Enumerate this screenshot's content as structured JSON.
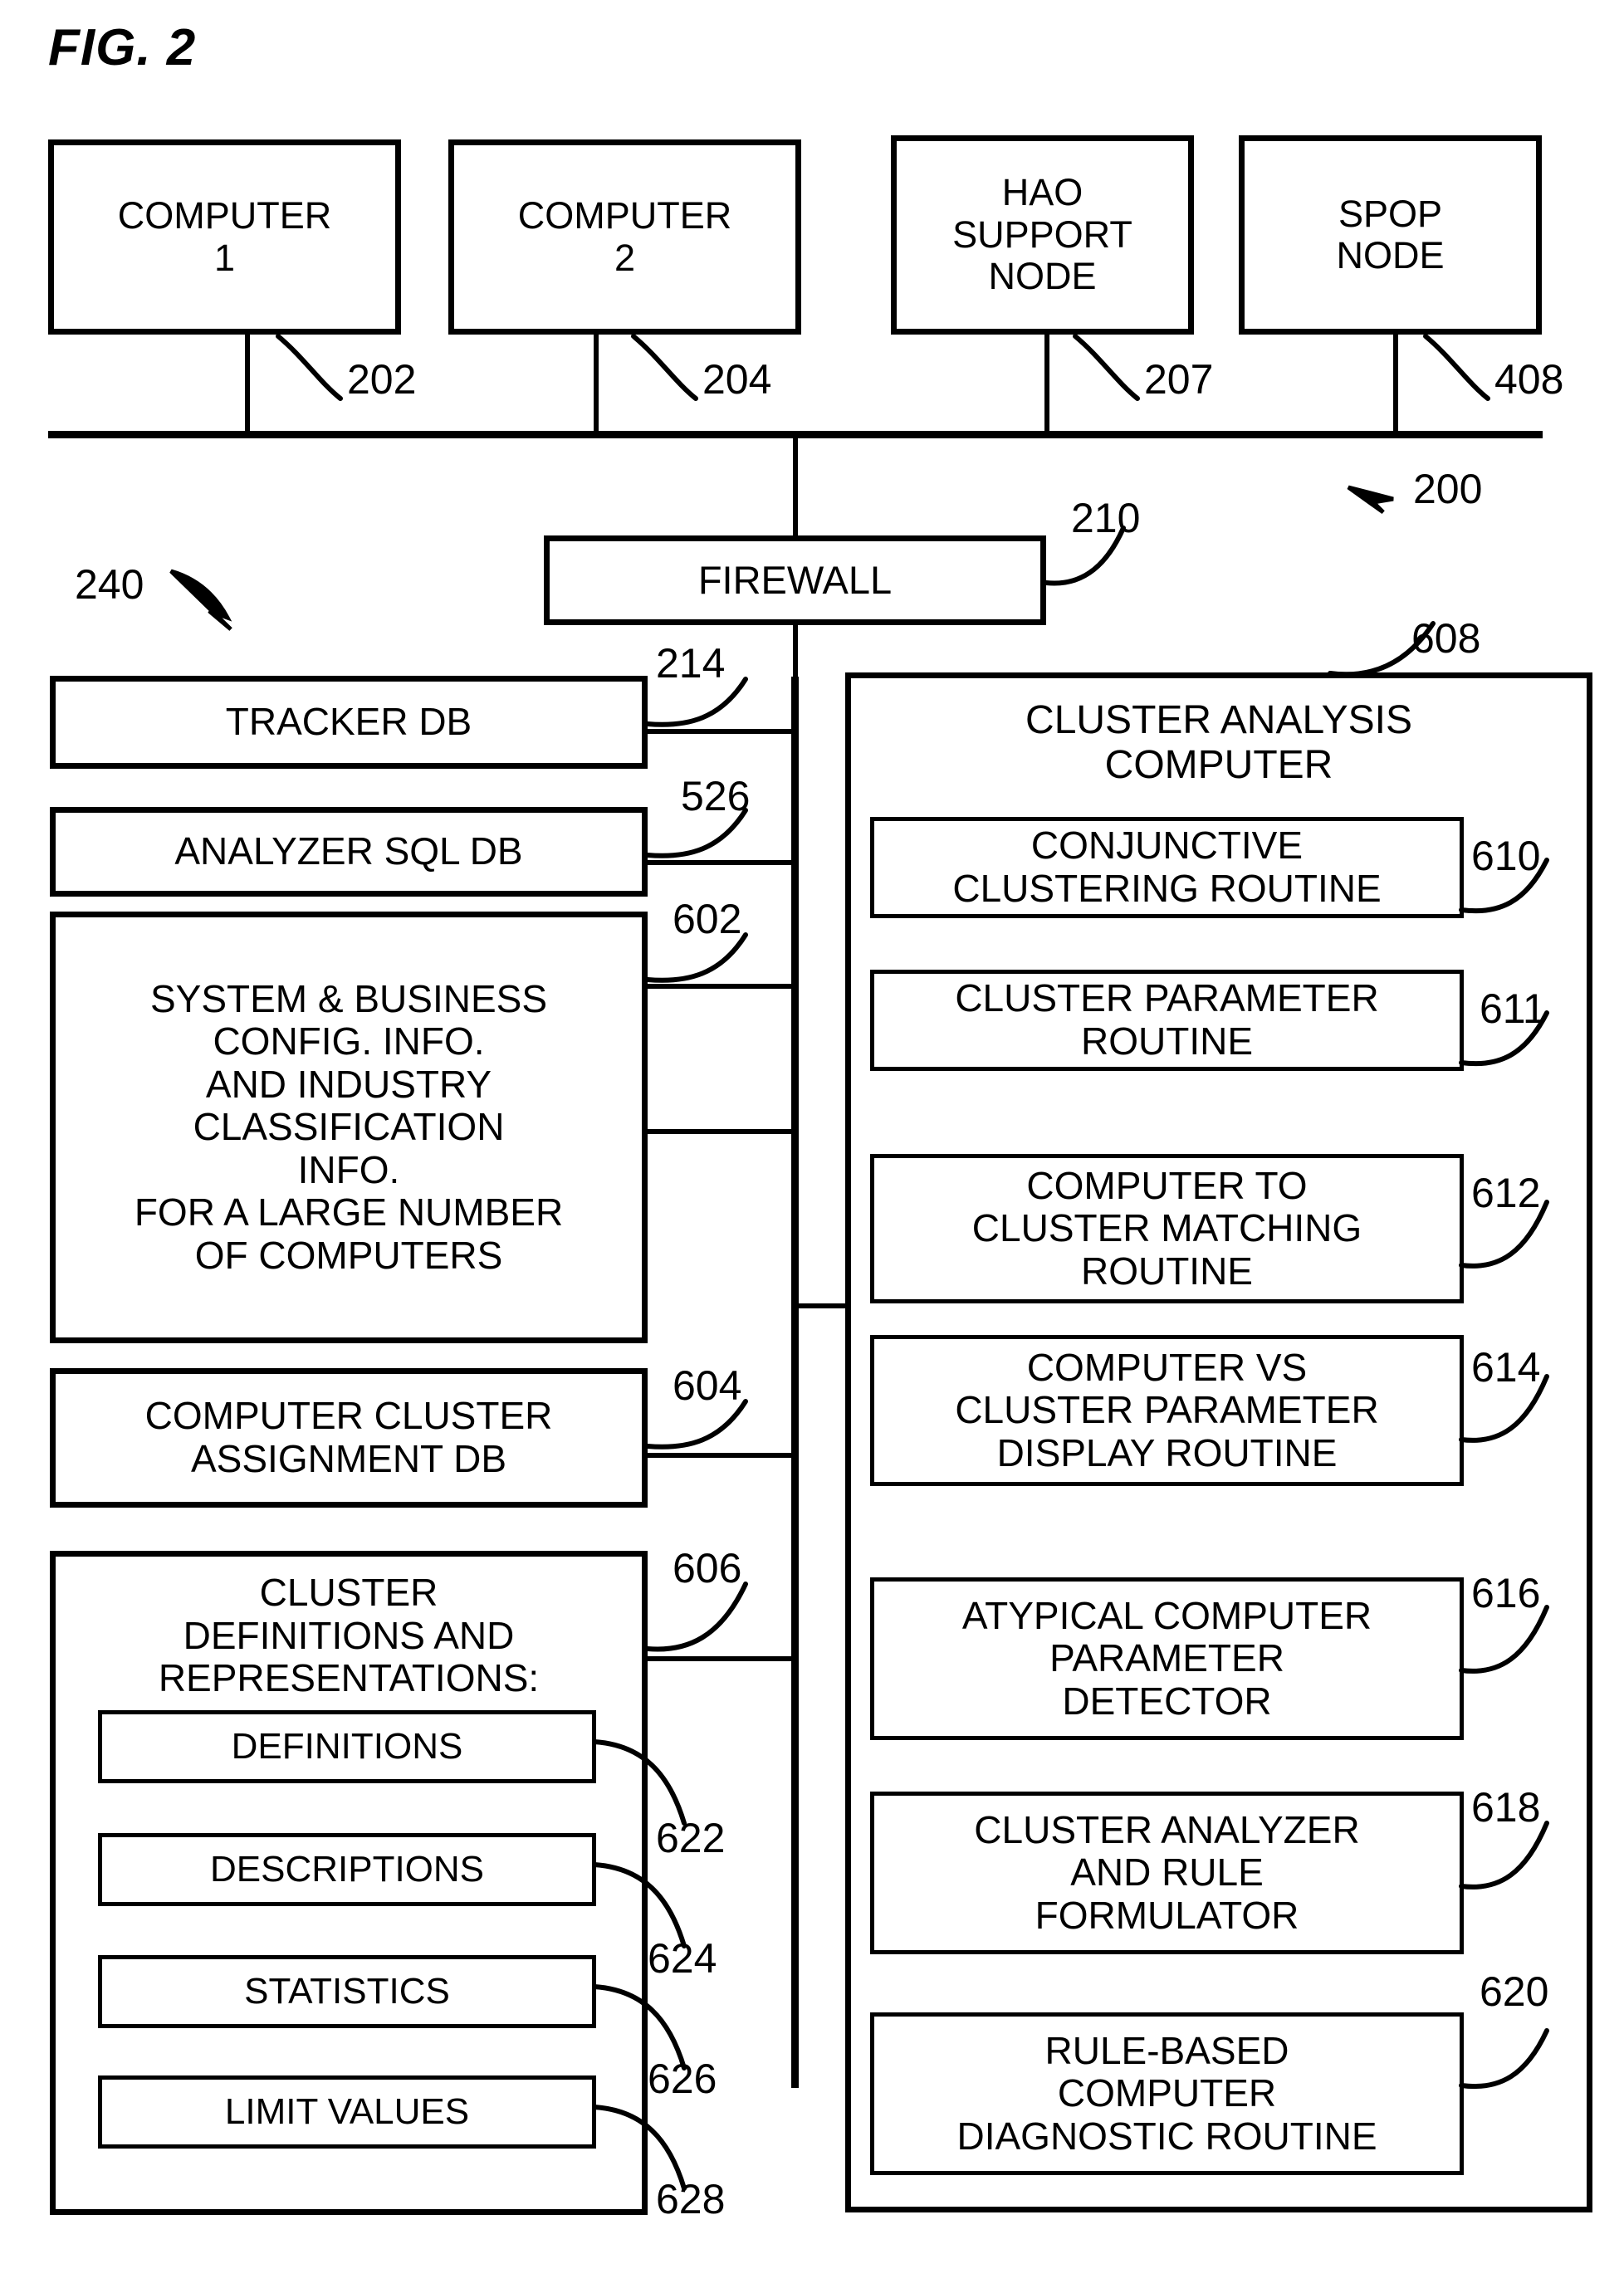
{
  "figure": {
    "title": "FIG. 2",
    "system_ref": "200",
    "subsystem_ref": "240"
  },
  "top_nodes": [
    {
      "label": "COMPUTER\n1",
      "ref": "202"
    },
    {
      "label": "COMPUTER\n2",
      "ref": "204"
    },
    {
      "label": "HAO\nSUPPORT\nNODE",
      "ref": "207"
    },
    {
      "label": "SPOP\nNODE",
      "ref": "408"
    }
  ],
  "firewall": {
    "label": "FIREWALL",
    "ref": "210"
  },
  "left_column": [
    {
      "label": "TRACKER DB",
      "ref": "214"
    },
    {
      "label": "ANALYZER SQL DB",
      "ref": "526"
    },
    {
      "label": "SYSTEM & BUSINESS\nCONFIG. INFO.\nAND INDUSTRY\nCLASSIFICATION\nINFO.\nFOR A LARGE NUMBER\nOF COMPUTERS",
      "ref": "602"
    },
    {
      "label": "COMPUTER CLUSTER\nASSIGNMENT DB",
      "ref": "604"
    }
  ],
  "cluster_definitions": {
    "label": "CLUSTER\nDEFINITIONS AND\nREPRESENTATIONS:",
    "ref": "606",
    "items": [
      {
        "label": "DEFINITIONS",
        "ref": "622"
      },
      {
        "label": "DESCRIPTIONS",
        "ref": "624"
      },
      {
        "label": "STATISTICS",
        "ref": "626"
      },
      {
        "label": "LIMIT VALUES",
        "ref": "628"
      }
    ]
  },
  "cluster_analysis_computer": {
    "label": "CLUSTER ANALYSIS\nCOMPUTER",
    "ref": "608",
    "routines": [
      {
        "label": "CONJUNCTIVE\nCLUSTERING ROUTINE",
        "ref": "610"
      },
      {
        "label": "CLUSTER PARAMETER\nROUTINE",
        "ref": "611"
      },
      {
        "label": "COMPUTER TO\nCLUSTER MATCHING\nROUTINE",
        "ref": "612"
      },
      {
        "label": "COMPUTER VS\nCLUSTER PARAMETER\nDISPLAY ROUTINE",
        "ref": "614"
      },
      {
        "label": "ATYPICAL COMPUTER\nPARAMETER\nDETECTOR",
        "ref": "616"
      },
      {
        "label": "CLUSTER ANALYZER\nAND RULE\nFORMULATOR",
        "ref": "618"
      },
      {
        "label": "RULE-BASED\nCOMPUTER\nDIAGNOSTIC ROUTINE",
        "ref": "620"
      }
    ]
  }
}
